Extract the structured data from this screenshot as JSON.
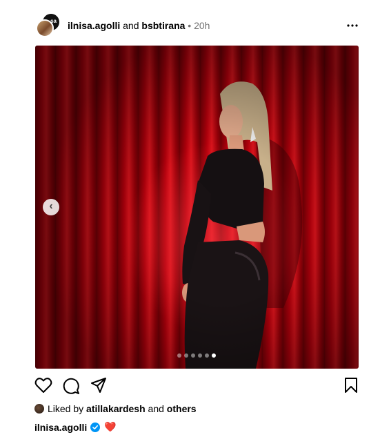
{
  "post": {
    "author": "ilnisa.agolli",
    "connector": "and",
    "collaborator": "bsbtirana",
    "separator": "•",
    "time": "20h",
    "avatar_badge": "sa"
  },
  "media": {
    "slide_count": 6,
    "active_slide": 6
  },
  "likes": {
    "prefix": "Liked by",
    "user": "atillakardesh",
    "connector": "and",
    "others": "others"
  },
  "caption": {
    "user": "ilnisa.agolli",
    "verified_icon": "verified-icon",
    "heart_emoji": "❤️"
  },
  "icons": [
    "more-icon",
    "heart-icon",
    "comment-icon",
    "share-icon",
    "bookmark-icon",
    "chevron-left-icon"
  ]
}
